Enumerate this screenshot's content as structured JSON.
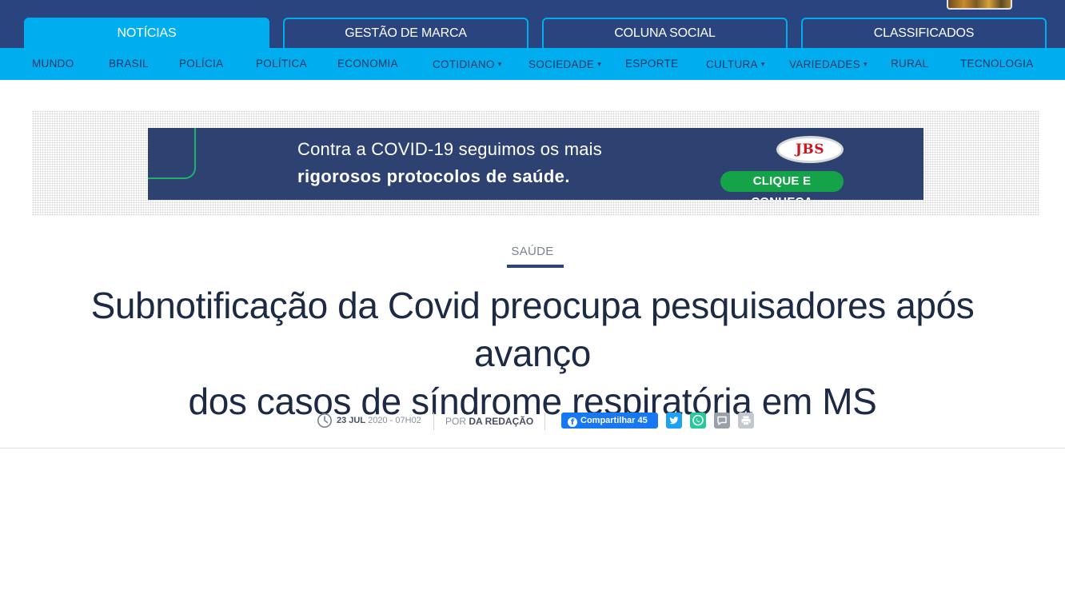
{
  "header": {
    "tabs": [
      {
        "label": "NOTÍCIAS",
        "active": true
      },
      {
        "label": "GESTÃO DE MARCA",
        "active": false
      },
      {
        "label": "COLUNA SOCIAL",
        "active": false
      },
      {
        "label": "CLASSIFICADOS",
        "active": false
      }
    ]
  },
  "subnav": {
    "items": [
      {
        "label": "MUNDO"
      },
      {
        "label": "BRASIL"
      },
      {
        "label": "POLÍCIA"
      },
      {
        "label": "POLÍTICA"
      },
      {
        "label": "ECONOMIA"
      },
      {
        "label": "COTIDIANO",
        "dropdown": true
      },
      {
        "label": "SOCIEDADE",
        "dropdown": true
      },
      {
        "label": "ESPORTE"
      },
      {
        "label": "CULTURA",
        "dropdown": true
      },
      {
        "label": "VARIEDADES",
        "dropdown": true
      },
      {
        "label": "RURAL"
      },
      {
        "label": "TECNOLOGIA"
      }
    ]
  },
  "ad": {
    "line1": "Contra a COVID-19 seguimos os mais",
    "line2": "rigorosos protocolos de saúde.",
    "logo_text": "JBS",
    "cta": "CLIQUE E CONHEÇA"
  },
  "article": {
    "category": "SAÚDE",
    "title_line1": "Subnotificação da Covid preocupa pesquisadores após avanço",
    "title_line2": "dos casos de síndrome respiratória em MS",
    "date_day": "23 JUL",
    "date_rest": "2020 - 07H02",
    "author_prefix": "POR",
    "author": "DA REDAÇÃO",
    "share_label": "Compartilhar 45"
  },
  "colors": {
    "navy": "#2a4480",
    "cyan": "#00aeef",
    "facebook": "#1877f2",
    "twitter": "#1da1f2",
    "whatsapp": "#25c99a"
  },
  "icons": [
    "clock-icon",
    "facebook-icon",
    "twitter-icon",
    "whatsapp-icon",
    "comment-icon",
    "print-icon"
  ]
}
